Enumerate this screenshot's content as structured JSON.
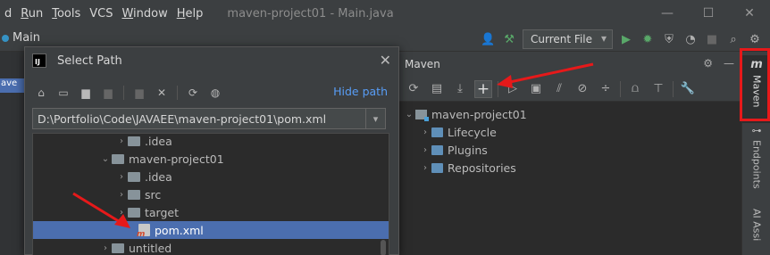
{
  "menu": {
    "items": [
      {
        "label": "d",
        "u": ""
      },
      {
        "label": "un",
        "u": "R"
      },
      {
        "label": "ools",
        "u": "T"
      },
      {
        "label": "VCS",
        "u": ""
      },
      {
        "label": "indow",
        "u": "W"
      },
      {
        "label": "elp",
        "u": "H"
      }
    ],
    "window_title": "maven-project01 - Main.java"
  },
  "toolbar": {
    "crumb": "Main",
    "run_config": "Current File"
  },
  "background": {
    "editor_tab_fragment": "ave"
  },
  "maven_panel": {
    "title": "Maven",
    "tree": [
      {
        "label": "maven-project01",
        "level": 0,
        "expanded": true
      },
      {
        "label": "Lifecycle",
        "level": 1,
        "expanded": false
      },
      {
        "label": "Plugins",
        "level": 1,
        "expanded": false
      },
      {
        "label": "Repositories",
        "level": 1,
        "expanded": false
      }
    ]
  },
  "right_sidebar": {
    "maven_label": "Maven",
    "maven_logo": "m",
    "endpoints_label": "Endpoints",
    "ai_label": "AI Assi"
  },
  "dialog": {
    "title": "Select Path",
    "logo_text": "IJ",
    "hide_path": "Hide path",
    "path_value": "D:\\Portfolio\\Code\\JAVAEE\\maven-project01\\pom.xml",
    "tree": [
      {
        "label": ".idea",
        "indent": 1,
        "arrow": "›",
        "type": "folder"
      },
      {
        "label": "maven-project01",
        "indent": 0,
        "arrow": "⌄",
        "type": "folder"
      },
      {
        "label": ".idea",
        "indent": 1,
        "arrow": "›",
        "type": "folder"
      },
      {
        "label": "src",
        "indent": 1,
        "arrow": "›",
        "type": "folder"
      },
      {
        "label": "target",
        "indent": 1,
        "arrow": "›",
        "type": "folder"
      },
      {
        "label": "pom.xml",
        "indent": 2,
        "arrow": "",
        "type": "pom",
        "selected": true
      },
      {
        "label": "untitled",
        "indent": 0,
        "arrow": "›",
        "type": "folder"
      }
    ]
  },
  "colors": {
    "accent_blue": "#589df6",
    "selection": "#4b6eaf",
    "annotation_red": "#e6191a"
  }
}
